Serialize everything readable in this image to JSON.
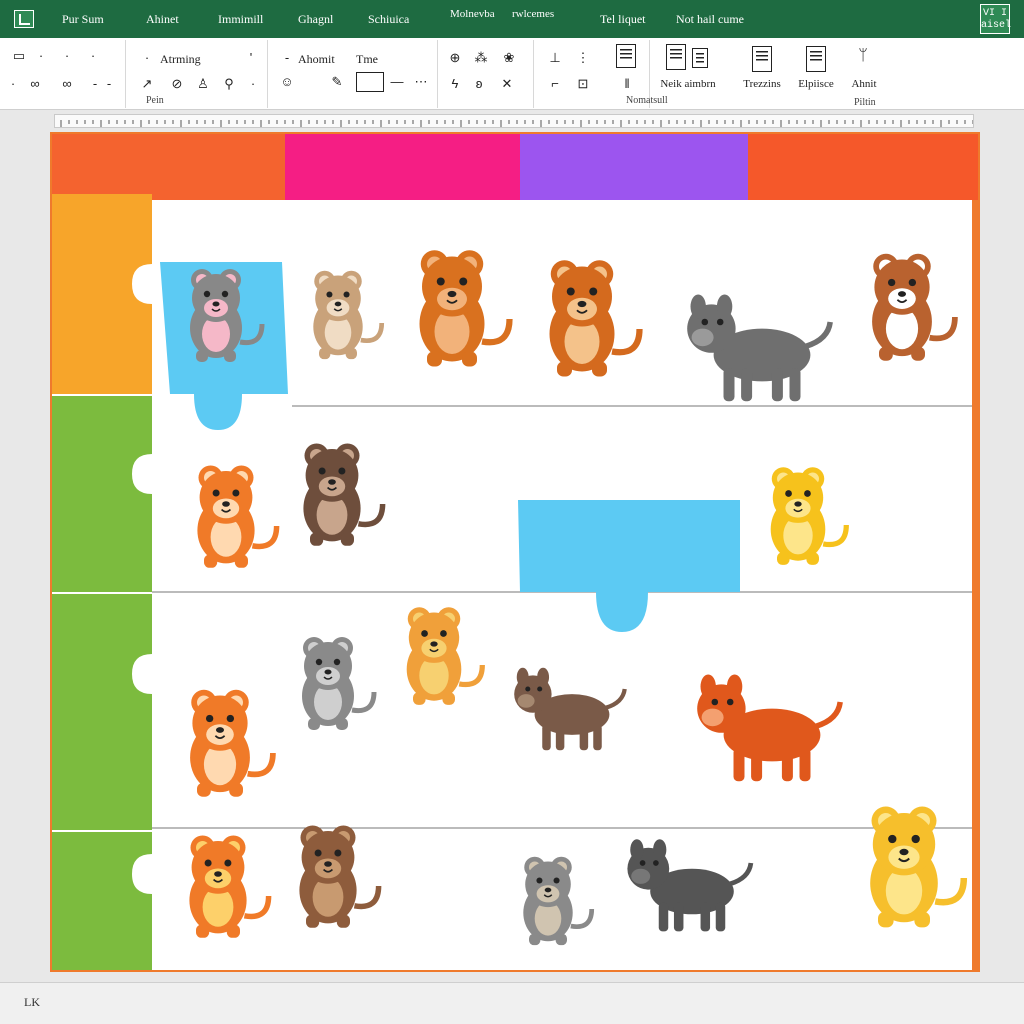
{
  "tabs": [
    "Pur Sum",
    "Ahinet",
    "Immimill",
    "Ghagnl",
    "Schiuica",
    "Molnevba",
    "rwlcemes",
    "Tel liquet",
    "Not hail cume"
  ],
  "window_badge": "VI I\naisel",
  "ribbon": {
    "group1": {
      "labels": [
        "Atrming"
      ],
      "group_label": "Pein"
    },
    "group2": {
      "labels": [
        "Ahomit",
        "Tme"
      ]
    },
    "group4": {
      "group_label": "Nomatsull"
    },
    "buttons": [
      {
        "label": "Neik aimbrn"
      },
      {
        "label": "Trezzins"
      },
      {
        "label": "Elpiisce"
      },
      {
        "label": "Ahnit",
        "sub": "Piltin"
      }
    ]
  },
  "status": {
    "text": "LK"
  },
  "colors": {
    "ribbon_green": "#1e6b41",
    "top_band": [
      "#f4632f",
      "#f51e84",
      "#9c55ef",
      "#f5582a"
    ],
    "left_pieces": [
      "#f7a52a",
      "#7cbb3e",
      "#7cbb3e",
      "#7cbb3e"
    ],
    "blue_piece": "#5ccaf3",
    "border": "#ef7a2c"
  },
  "animals": [
    {
      "name": "mouse",
      "body": "#888888",
      "accent": "#f5b8c8"
    },
    {
      "name": "hamster",
      "body": "#c9a27a",
      "accent": "#f0dcc4"
    },
    {
      "name": "cougar",
      "body": "#d9711f",
      "accent": "#f2b27a"
    },
    {
      "name": "lion-cub",
      "body": "#d46a1e",
      "accent": "#f4c28a"
    },
    {
      "name": "donkey",
      "body": "#6f6f6f",
      "accent": "#9a9a9a"
    },
    {
      "name": "puppy",
      "body": "#b9622f",
      "accent": "#ffffff"
    },
    {
      "name": "kitten",
      "body": "#f07a28",
      "accent": "#ffd9b0"
    },
    {
      "name": "monkey",
      "body": "#6e4e3c",
      "accent": "#c8a58c"
    },
    {
      "name": "lion",
      "body": "#f6c21c",
      "accent": "#fde58a"
    },
    {
      "name": "fox",
      "body": "#f07a28",
      "accent": "#ffd9b0"
    },
    {
      "name": "koala",
      "body": "#8a8a8a",
      "accent": "#cfcfcf"
    },
    {
      "name": "giraffe-cub",
      "body": "#f0a03a",
      "accent": "#f7d070"
    },
    {
      "name": "bison",
      "body": "#7a5a48",
      "accent": "#a58870"
    },
    {
      "name": "deer",
      "body": "#e0581c",
      "accent": "#f4a070"
    },
    {
      "name": "tiger",
      "body": "#f07a28",
      "accent": "#fdd06a"
    },
    {
      "name": "bear-cub",
      "body": "#8e5c3c",
      "accent": "#c89a70"
    },
    {
      "name": "sloth",
      "body": "#8a8a8a",
      "accent": "#d0c4b0"
    },
    {
      "name": "boar",
      "body": "#555555",
      "accent": "#777777"
    },
    {
      "name": "golden-puppy",
      "body": "#f6bf2c",
      "accent": "#fde58a"
    }
  ]
}
